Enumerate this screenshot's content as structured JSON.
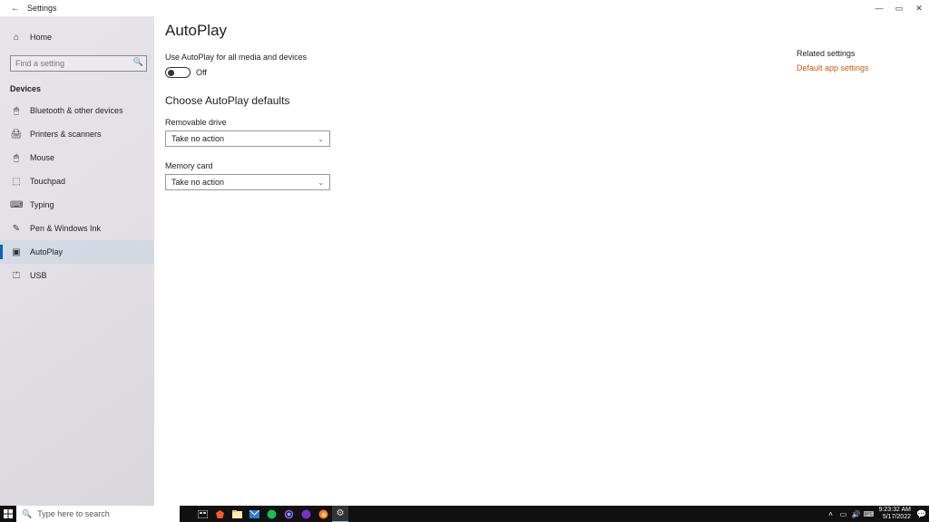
{
  "titlebar": {
    "back_icon": "←",
    "title": "Settings"
  },
  "winctrl": {
    "min": "—",
    "max": "▭",
    "close": "✕"
  },
  "sidebar": {
    "home": {
      "icon": "⌂",
      "label": "Home"
    },
    "search_placeholder": "Find a setting",
    "search_icon": "🔍",
    "section": "Devices",
    "items": [
      {
        "icon": "🖱",
        "label": "Bluetooth & other devices"
      },
      {
        "icon": "🖨",
        "label": "Printers & scanners"
      },
      {
        "icon": "🖱",
        "label": "Mouse"
      },
      {
        "icon": "⬚",
        "label": "Touchpad"
      },
      {
        "icon": "⌨",
        "label": "Typing"
      },
      {
        "icon": "✎",
        "label": "Pen & Windows Ink"
      },
      {
        "icon": "▣",
        "label": "AutoPlay"
      },
      {
        "icon": "⏍",
        "label": "USB"
      }
    ],
    "active_index": 6
  },
  "main": {
    "title": "AutoPlay",
    "toggle_desc": "Use AutoPlay for all media and devices",
    "toggle_state": "Off",
    "defaults_heading": "Choose AutoPlay defaults",
    "fields": [
      {
        "label": "Removable drive",
        "value": "Take no action"
      },
      {
        "label": "Memory card",
        "value": "Take no action"
      }
    ],
    "chevron": "⌄"
  },
  "related": {
    "title": "Related settings",
    "link": "Default app settings"
  },
  "taskbar": {
    "search_placeholder": "Type here to search",
    "tray": {
      "up": "˄",
      "net": "▭",
      "vol": "🔊",
      "lang": "⌨"
    },
    "time": "9:23:32 AM",
    "date": "5/17/2022",
    "notif": "💬"
  }
}
